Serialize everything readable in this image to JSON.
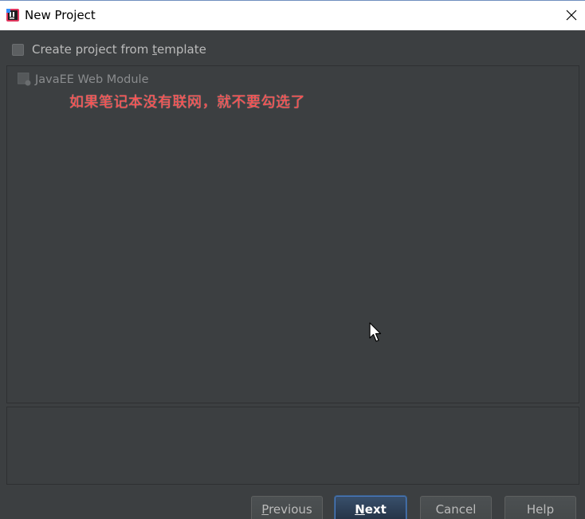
{
  "window": {
    "title": "New Project",
    "close_glyph": "✕"
  },
  "template_option": {
    "label_before": "Create project from ",
    "label_underlined": "t",
    "label_after": "emplate",
    "checked": false
  },
  "template_list": {
    "items": [
      {
        "label": "JavaEE Web Module",
        "icon": "module-icon",
        "enabled": false
      }
    ]
  },
  "annotation": {
    "text": "如果笔记本没有联网，就不要勾选了",
    "color": "#ff4a4a"
  },
  "buttons": {
    "previous": {
      "underlined": "P",
      "rest": "revious"
    },
    "next": {
      "underlined": "N",
      "rest": "ext"
    },
    "cancel": {
      "label": "Cancel"
    },
    "help": {
      "label": "Help"
    }
  },
  "colors": {
    "background": "#3c3f41",
    "titlebar": "#ffffff",
    "text": "#bbbbbb",
    "default_button_border": "#4a7ac2"
  }
}
